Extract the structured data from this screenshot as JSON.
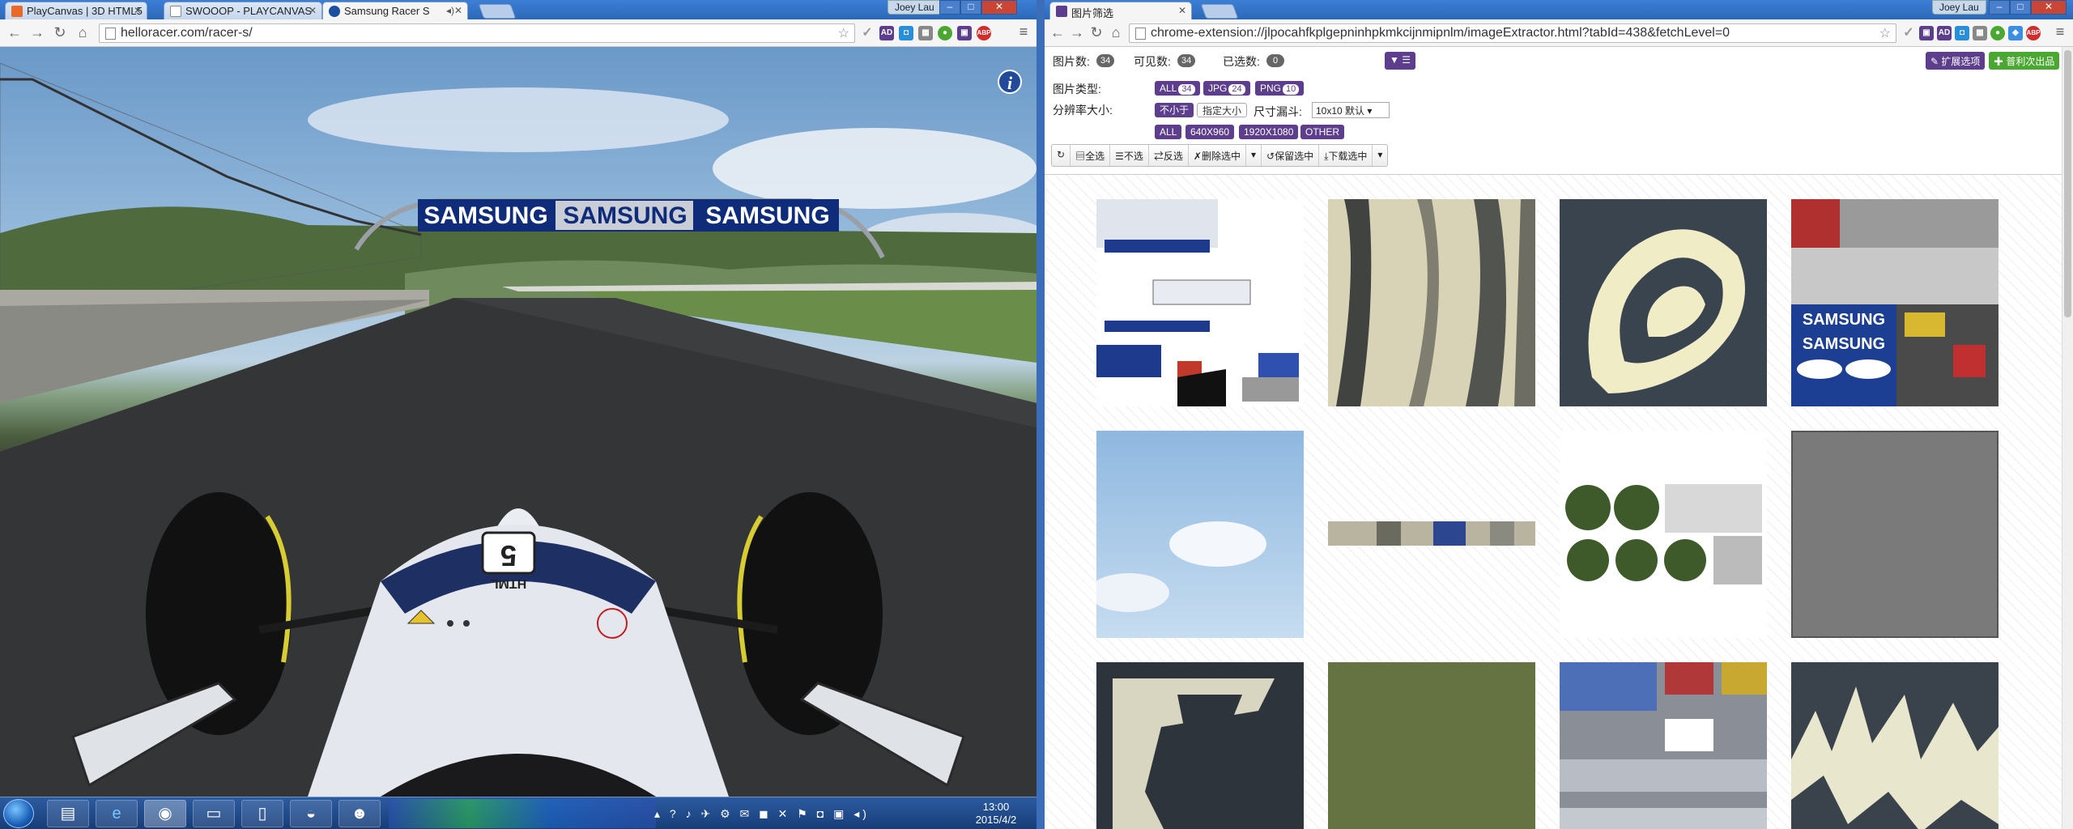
{
  "left_window": {
    "user": "Joey Lau",
    "tabs": [
      {
        "title": "PlayCanvas | 3D HTML5"
      },
      {
        "title": "SWOOOP - PLAYCANVAS"
      },
      {
        "title": "Samsung Racer S"
      }
    ],
    "url": "helloracer.com/racer-s/",
    "game": {
      "banner_text": [
        "SAMSUNG",
        "SAMSUNG",
        "SAMSUNG"
      ],
      "car_number": "5",
      "car_label": "HTML",
      "info_icon": "i"
    }
  },
  "right_window": {
    "user": "Joey Lau",
    "tab_title": "图片筛选",
    "url": "chrome-extension://jlpocahfkplgepninhpkmkcijnmipnlm/imageExtractor.html?tabId=438&fetchLevel=0",
    "counts": {
      "total_label": "图片数:",
      "total": "34",
      "visible_label": "可见数:",
      "visible": "34",
      "selected_label": "已选数:",
      "selected": "0"
    },
    "header_buttons": {
      "options": "扩展选项",
      "product": "普利次出品"
    },
    "type_filter": {
      "label": "图片类型:",
      "items": [
        {
          "name": "ALL",
          "count": "34"
        },
        {
          "name": "JPG",
          "count": "24"
        },
        {
          "name": "PNG",
          "count": "10"
        }
      ]
    },
    "resolution": {
      "label": "分辨率大小:",
      "no_less": "不小于",
      "specify": "指定大小",
      "funnel_label": "尺寸漏斗:",
      "funnel_value": "10x10 默认",
      "sizes": [
        "ALL",
        "640X960",
        "1920X1080",
        "OTHER"
      ]
    },
    "actions": [
      "全选",
      "不选",
      "反选",
      "删除选中",
      "保留选中",
      "下载选中"
    ]
  },
  "taskbar": {
    "time": "13:00",
    "date": "2015/4/2"
  },
  "colors": {
    "accent": "#5d3e8c",
    "green_button": "#4aa832",
    "chrome_blue": "#2c68b8"
  }
}
